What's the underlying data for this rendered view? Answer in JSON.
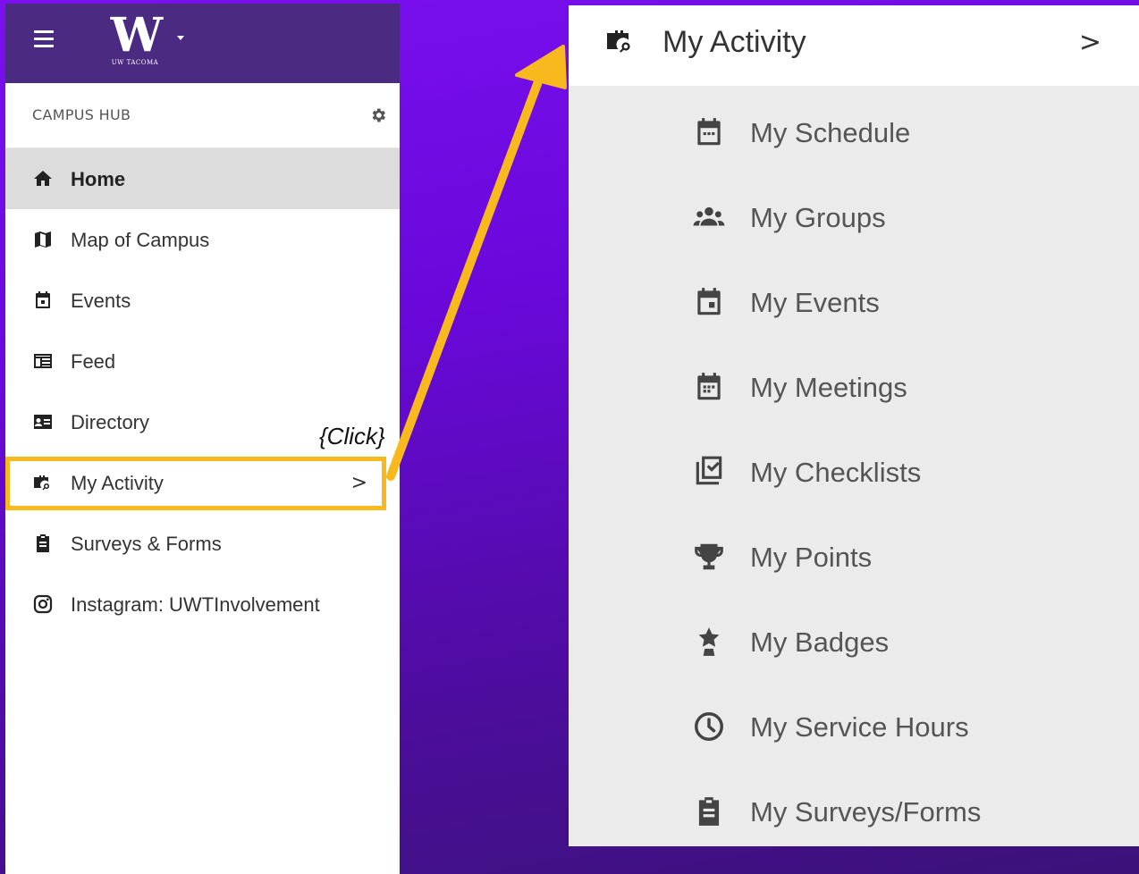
{
  "sidebar": {
    "logo_letter": "W",
    "logo_subtitle": "UW TACOMA",
    "section_title": "CAMPUS HUB",
    "items": [
      {
        "label": "Home",
        "icon": "home-icon"
      },
      {
        "label": "Map of Campus",
        "icon": "map-icon"
      },
      {
        "label": "Events",
        "icon": "calendar-icon"
      },
      {
        "label": "Feed",
        "icon": "feed-icon"
      },
      {
        "label": "Directory",
        "icon": "id-card-icon"
      },
      {
        "label": "My Activity",
        "icon": "briefcase-search-icon",
        "chevron": ">"
      },
      {
        "label": "Surveys & Forms",
        "icon": "clipboard-icon"
      },
      {
        "label": "Instagram: UWTInvolvement",
        "icon": "instagram-icon"
      }
    ]
  },
  "annotation": {
    "click_label": "{Click}",
    "highlight_color": "#f8b91e"
  },
  "submenu": {
    "title": "My Activity",
    "chevron": ">",
    "items": [
      {
        "label": "My Schedule",
        "icon": "calendar-dots-icon"
      },
      {
        "label": "My Groups",
        "icon": "group-icon"
      },
      {
        "label": "My Events",
        "icon": "calendar-icon"
      },
      {
        "label": "My Meetings",
        "icon": "calendar-grid-icon"
      },
      {
        "label": "My Checklists",
        "icon": "checklist-icon"
      },
      {
        "label": "My Points",
        "icon": "trophy-icon"
      },
      {
        "label": "My Badges",
        "icon": "badge-star-icon"
      },
      {
        "label": "My Service Hours",
        "icon": "clock-icon"
      },
      {
        "label": "My Surveys/Forms",
        "icon": "clipboard-icon"
      }
    ]
  },
  "colors": {
    "brand_purple": "#4b2a82",
    "active_bg": "#dcdcdc",
    "submenu_bg": "#ebebeb",
    "arrow": "#f8b91e"
  }
}
